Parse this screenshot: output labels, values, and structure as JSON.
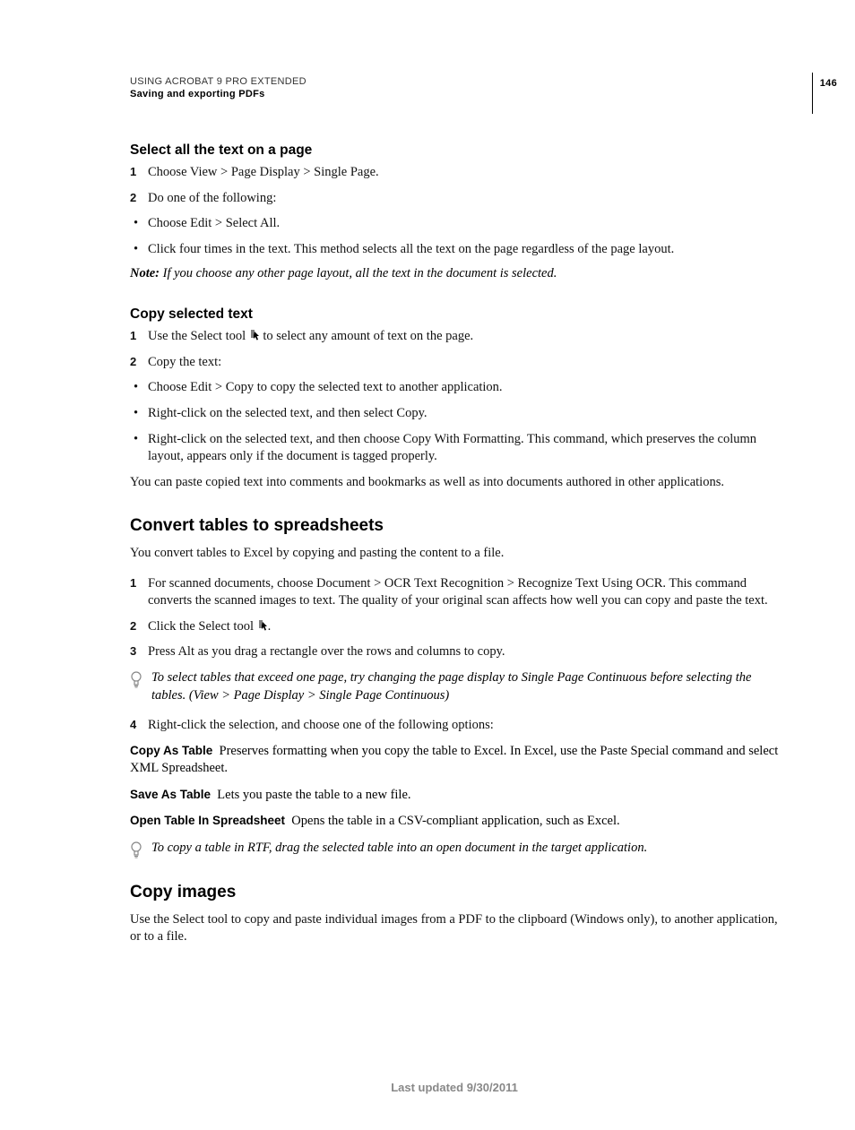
{
  "header": {
    "line1": "USING ACROBAT 9 PRO EXTENDED",
    "line2": "Saving and exporting PDFs",
    "page_number": "146"
  },
  "section1": {
    "heading": "Select all the text on a page",
    "steps": [
      "Choose View > Page Display > Single Page.",
      "Do one of the following:"
    ],
    "bullets": [
      "Choose Edit > Select All.",
      "Click four times in the text. This method selects all the text on the page regardless of the page layout."
    ],
    "note_label": "Note:",
    "note_body": "If you choose any other page layout, all the text in the document is selected."
  },
  "section2": {
    "heading": "Copy selected text",
    "step1_prefix": "Use the Select tool ",
    "step1_suffix": " to select any amount of text on the page.",
    "step2": "Copy the text:",
    "bullets": [
      "Choose Edit > Copy to copy the selected text to another application.",
      "Right-click on the selected text, and then select Copy.",
      "Right-click on the selected text, and then choose Copy With Formatting. This command, which preserves the column layout, appears only if the document is tagged properly."
    ],
    "after": "You can paste copied text into comments and bookmarks as well as into documents authored in other applications."
  },
  "section3": {
    "heading": "Convert tables to spreadsheets",
    "intro": "You convert tables to Excel by copying and pasting the content to a file.",
    "step1": "For scanned documents, choose Document > OCR Text Recognition > Recognize Text Using OCR. This command converts the scanned images to text. The quality of your original scan affects how well you can copy and paste the text.",
    "step2_prefix": "Click the Select tool ",
    "step2_suffix": ".",
    "step3": "Press Alt as you drag a rectangle over the rows and columns to copy.",
    "tip1": "To select tables that exceed one page, try changing the page display to Single Page Continuous before selecting the tables. (View > Page Display > Single Page Continuous)",
    "step4": "Right-click the selection, and choose one of the following options:",
    "defs": [
      {
        "term": "Copy As Table",
        "body": "Preserves formatting when you copy the table to Excel. In Excel, use the Paste Special command and select XML Spreadsheet."
      },
      {
        "term": "Save As Table",
        "body": "Lets you paste the table to a new file."
      },
      {
        "term": "Open Table In Spreadsheet",
        "body": "Opens the table in a CSV-compliant application, such as Excel."
      }
    ],
    "tip2": "To copy a table in RTF, drag the selected table into an open document in the target application."
  },
  "section4": {
    "heading": "Copy images",
    "body": "Use the Select tool to copy and paste individual images from a PDF to the clipboard (Windows only), to another application, or to a file."
  },
  "footer": "Last updated 9/30/2011"
}
